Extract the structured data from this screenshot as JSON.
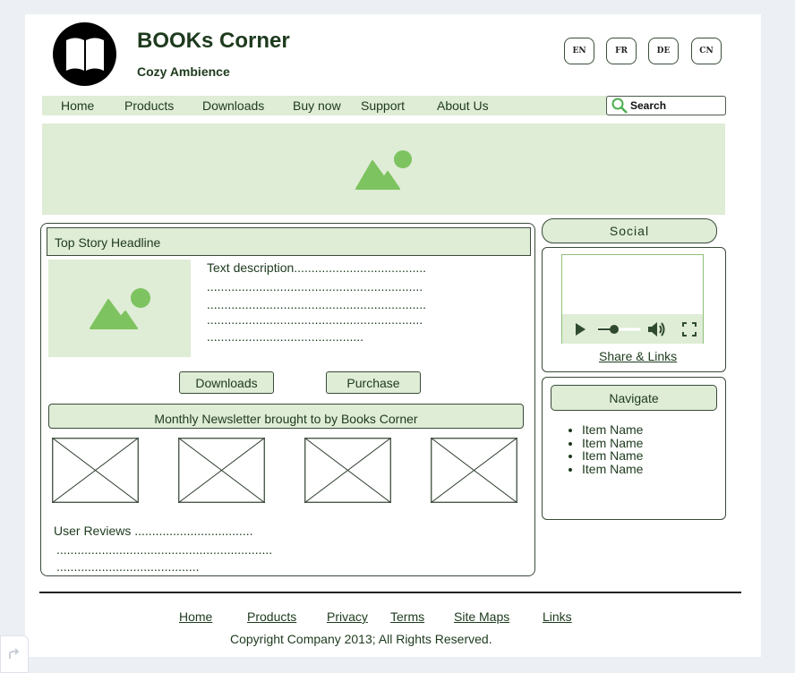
{
  "header": {
    "brand_title": "BOOKs Corner",
    "brand_subtitle": "Cozy Ambience",
    "logo_icon": "book-icon",
    "languages": [
      "EN",
      "FR",
      "DE",
      "CN"
    ]
  },
  "nav": {
    "items": [
      "Home",
      "Products",
      "Downloads",
      "Buy now",
      "Support",
      "About Us"
    ],
    "search_label": "Search"
  },
  "story": {
    "headline": "Top Story Headline",
    "description_lines": [
      "Text description......................................",
      "..............................................................",
      "...............................................................",
      "..............................................................",
      "............................................."
    ],
    "downloads_button": "Downloads",
    "purchase_button": "Purchase"
  },
  "newsletter": {
    "title": "Monthly Newsletter brought to by Books Corner"
  },
  "reviews": {
    "lines": [
      "User Reviews ..................................",
      "..............................................................",
      "........................................."
    ]
  },
  "sidebar": {
    "social_title": "Social",
    "share_link": "Share & Links",
    "navigate_title": "Navigate",
    "items": [
      "Item Name",
      "Item Name",
      "Item Name",
      "Item Name"
    ]
  },
  "footer": {
    "links": [
      "Home",
      "Products",
      "Privacy",
      "Terms",
      "Site Maps",
      "Links"
    ],
    "copyright": "Copyright Company 2013; All Rights Reserved."
  },
  "colors": {
    "accent_light": "#dfecd6",
    "accent_green": "#7dc35f",
    "text": "#1d3a1d",
    "border": "#3a4a3a"
  }
}
